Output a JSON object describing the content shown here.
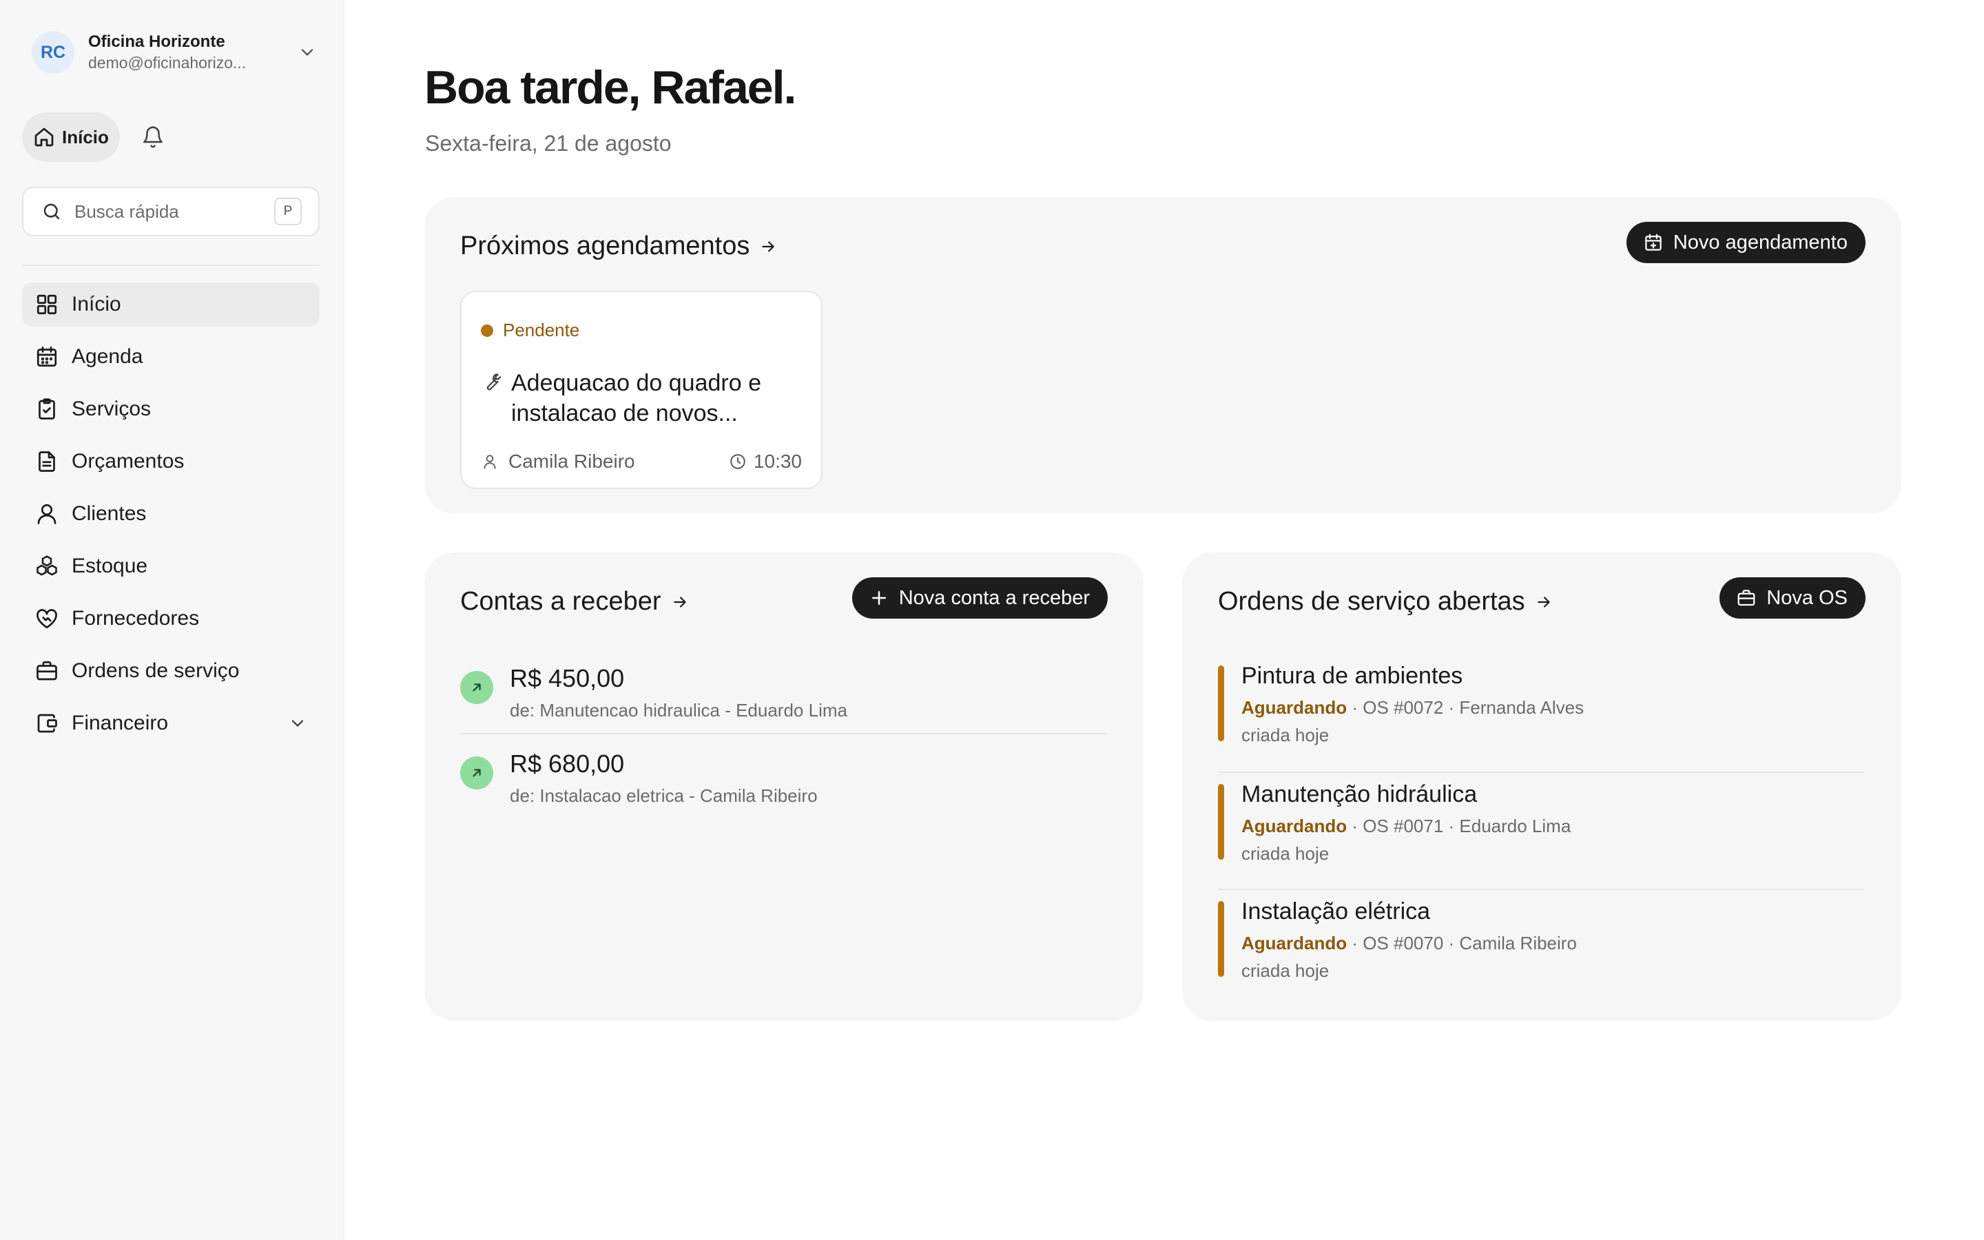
{
  "account": {
    "initials": "RC",
    "name": "Oficina Horizonte",
    "email": "demo@oficinahorizo..."
  },
  "top_tabs": {
    "home_label": "Início"
  },
  "search": {
    "placeholder": "Busca rápida",
    "shortcut": "P"
  },
  "nav": {
    "items": [
      {
        "label": "Início",
        "icon": "grid-icon",
        "active": true
      },
      {
        "label": "Agenda",
        "icon": "calendar-icon"
      },
      {
        "label": "Serviços",
        "icon": "clipboard-check-icon"
      },
      {
        "label": "Orçamentos",
        "icon": "document-icon"
      },
      {
        "label": "Clientes",
        "icon": "user-icon"
      },
      {
        "label": "Estoque",
        "icon": "boxes-icon"
      },
      {
        "label": "Fornecedores",
        "icon": "handshake-heart-icon"
      },
      {
        "label": "Ordens de serviço",
        "icon": "briefcase-icon"
      },
      {
        "label": "Financeiro",
        "icon": "wallet-icon",
        "expandable": true
      }
    ]
  },
  "main": {
    "greeting": "Boa tarde, Rafael.",
    "date": "Sexta-feira, 21 de agosto"
  },
  "appointments": {
    "title": "Próximos agendamentos",
    "new_button": "Novo agendamento",
    "items": [
      {
        "status": "Pendente",
        "title": "Adequacao do quadro e instalacao de novos...",
        "client": "Camila Ribeiro",
        "time": "10:30"
      }
    ]
  },
  "receivables": {
    "title": "Contas a receber",
    "new_button": "Nova conta a receber",
    "items": [
      {
        "amount": "R$ 450,00",
        "description": "de: Manutencao hidraulica - Eduardo Lima"
      },
      {
        "amount": "R$ 680,00",
        "description": "de: Instalacao eletrica - Camila Ribeiro"
      }
    ]
  },
  "service_orders": {
    "title": "Ordens de serviço abertas",
    "new_button": "Nova OS",
    "items": [
      {
        "title": "Pintura de ambientes",
        "status": "Aguardando",
        "details": " · OS #0072 · Fernanda Alves",
        "created": "criada hoje"
      },
      {
        "title": "Manutenção hidráulica",
        "status": "Aguardando",
        "details": " · OS #0071 · Eduardo Lima",
        "created": "criada hoje"
      },
      {
        "title": "Instalação elétrica",
        "status": "Aguardando",
        "details": " · OS #0070 · Camila Ribeiro",
        "created": "criada hoje"
      }
    ]
  },
  "colors": {
    "accent_dark": "#1d1d1d",
    "pending": "#b27312",
    "income_green": "#8fdc9f",
    "avatar_blue": "#2a6fc4"
  }
}
